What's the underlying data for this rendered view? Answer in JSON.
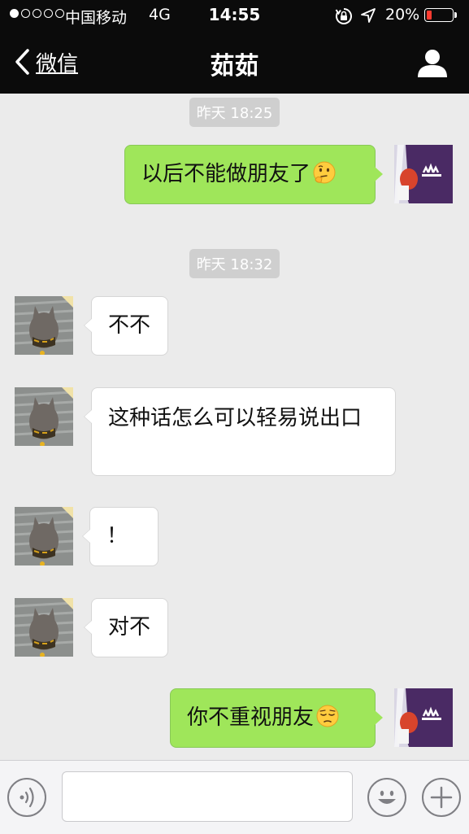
{
  "status_bar": {
    "carrier": "中国移动",
    "network": "4G",
    "time": "14:55",
    "battery_percent": "20%",
    "battery_level": 0.2,
    "signal_strength": 1,
    "signal_max": 5,
    "icons": [
      "orientation-lock-icon",
      "location-arrow-icon",
      "battery-icon"
    ]
  },
  "nav": {
    "back_label": "微信",
    "title": "茹茹",
    "back_icon": "chevron-left-icon",
    "profile_icon": "person-icon"
  },
  "messages": [
    {
      "type": "timestamp",
      "text": "昨天 18:25"
    },
    {
      "type": "message",
      "side": "out",
      "text": "以后不能做朋友了",
      "emoji": "thinking-face-emoji"
    },
    {
      "type": "timestamp",
      "text": "昨天 18:32"
    },
    {
      "type": "message",
      "side": "in",
      "text": "不不"
    },
    {
      "type": "message",
      "side": "in",
      "text": "这种话怎么可以轻易说出口"
    },
    {
      "type": "message",
      "side": "in",
      "text": "！"
    },
    {
      "type": "message",
      "side": "in",
      "text": "对不"
    },
    {
      "type": "message",
      "side": "out",
      "text": "你不重视朋友",
      "emoji": "pensive-face-emoji"
    }
  ],
  "input_bar": {
    "voice_icon": "voice-icon",
    "emoji_icon": "smiley-icon",
    "add_icon": "plus-icon",
    "input_value": ""
  },
  "colors": {
    "outgoing_bubble": "#9fe65a",
    "incoming_bubble": "#ffffff",
    "chat_background": "#ebebeb",
    "header_background": "#0b0b0b"
  }
}
